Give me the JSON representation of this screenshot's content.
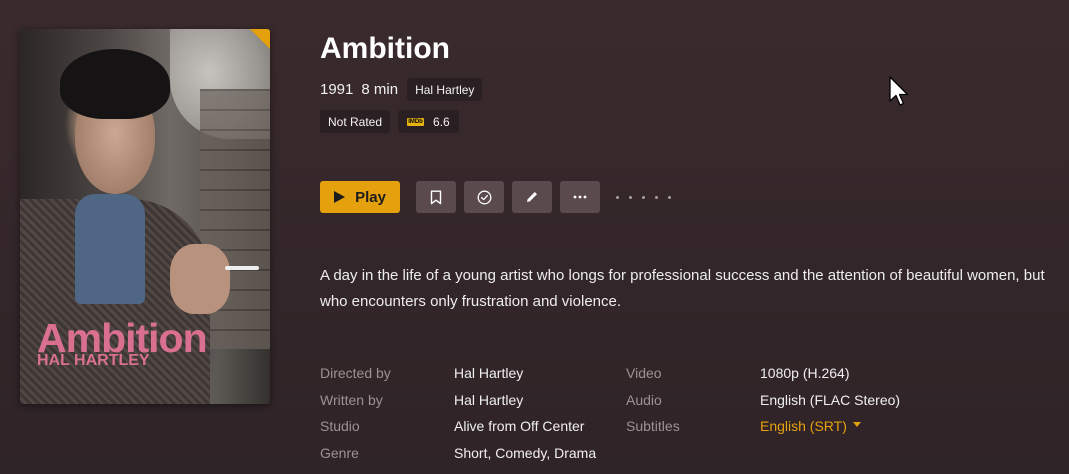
{
  "poster": {
    "title_text": "Ambition",
    "subtitle_text": "HAL HARTLEY"
  },
  "movie": {
    "title": "Ambition",
    "year": "1991",
    "duration": "8 min",
    "director_chip": "Hal Hartley",
    "rating": "Not Rated",
    "imdb_label": "IMDb",
    "imdb_score": "6.6",
    "summary": "A day in the life of a young artist who longs for professional success and the attention of beautiful women, but who encounters only frustration and violence."
  },
  "actions": {
    "play_label": "Play",
    "buttons": [
      "bookmark-icon",
      "check-circle-icon",
      "pencil-icon",
      "more-icon"
    ]
  },
  "details": {
    "left": [
      {
        "label": "Directed by",
        "value": "Hal Hartley"
      },
      {
        "label": "Written by",
        "value": "Hal Hartley"
      },
      {
        "label": "Studio",
        "value": "Alive from Off Center"
      },
      {
        "label": "Genre",
        "value": "Short, Comedy, Drama"
      }
    ],
    "right": [
      {
        "label": "Video",
        "value": "1080p (H.264)"
      },
      {
        "label": "Audio",
        "value": "English (FLAC Stereo)"
      },
      {
        "label": "Subtitles",
        "value": "English (SRT)"
      }
    ]
  },
  "colors": {
    "accent": "#e5a00d",
    "background": "#33262a",
    "button": "#5a4a4e"
  }
}
